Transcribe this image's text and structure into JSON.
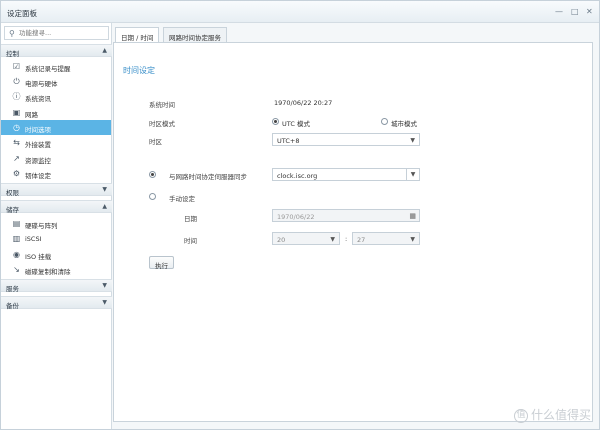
{
  "window": {
    "title": "设定面板"
  },
  "controls": {
    "minimize": "—",
    "maximize": "□",
    "close": "✕"
  },
  "search": {
    "placeholder": "功能搜寻..."
  },
  "sidebar": {
    "sections": [
      {
        "label": "控制",
        "arrow": "▲"
      },
      {
        "label": "权限",
        "arrow": "▼"
      },
      {
        "label": "储存",
        "arrow": "▲"
      },
      {
        "label": "服务",
        "arrow": "▼"
      },
      {
        "label": "备份",
        "arrow": "▼"
      }
    ],
    "control_items": [
      {
        "label": "系统记录与提醒",
        "icon": "☑"
      },
      {
        "label": "电源与硬体",
        "icon": "⏻"
      },
      {
        "label": "系统资讯",
        "icon": "ⓘ"
      },
      {
        "label": "网路",
        "icon": "▣"
      },
      {
        "label": "时间选项",
        "icon": "◷"
      },
      {
        "label": "外接装置",
        "icon": "⇆"
      },
      {
        "label": "资源监控",
        "icon": "↗"
      },
      {
        "label": "韧体设定",
        "icon": "⚙"
      }
    ],
    "storage_items": [
      {
        "label": "硬碟与阵列",
        "icon": "▤"
      },
      {
        "label": "iSCSI",
        "icon": "▥"
      },
      {
        "label": "ISO 挂载",
        "icon": "◉"
      },
      {
        "label": "磁碟复制和清除",
        "icon": "↘"
      }
    ]
  },
  "tabs": [
    {
      "label": "日期 / 时间"
    },
    {
      "label": "网路时间协定服务"
    }
  ],
  "content": {
    "section_title": "时间设定",
    "system_time_label": "系统时间",
    "system_time_value": "1970/06/22 20:27",
    "tz_mode_label": "时区模式",
    "tz_mode_utc": "UTC 模式",
    "tz_mode_city": "城市模式",
    "tz_label": "时区",
    "tz_value": "UTC+8",
    "sync_label": "与网路时间协定伺服器同步",
    "ntp_server": "clock.isc.org",
    "manual_label": "手动设定",
    "date_label": "日期",
    "date_value": "1970/06/22",
    "time_label": "时间",
    "hour_value": "20",
    "minute_value": "27",
    "time_sep": ":",
    "apply_button": "执行"
  },
  "icons": {
    "dropdown": "▼",
    "calendar": "▦",
    "search": "🔍"
  },
  "watermark": {
    "text": "什么值得买",
    "icon": "值"
  },
  "colors": {
    "active_nav": "#5bb4e5",
    "section_title": "#3a8fc9"
  }
}
